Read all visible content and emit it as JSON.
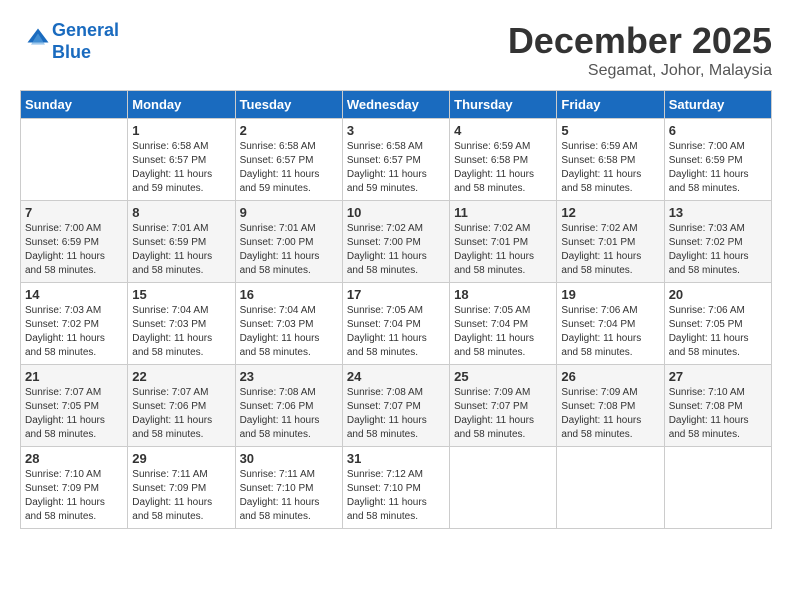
{
  "logo": {
    "line1": "General",
    "line2": "Blue"
  },
  "title": "December 2025",
  "location": "Segamat, Johor, Malaysia",
  "headers": [
    "Sunday",
    "Monday",
    "Tuesday",
    "Wednesday",
    "Thursday",
    "Friday",
    "Saturday"
  ],
  "weeks": [
    [
      {
        "day": "",
        "sunrise": "",
        "sunset": "",
        "daylight": ""
      },
      {
        "day": "1",
        "sunrise": "Sunrise: 6:58 AM",
        "sunset": "Sunset: 6:57 PM",
        "daylight": "Daylight: 11 hours and 59 minutes."
      },
      {
        "day": "2",
        "sunrise": "Sunrise: 6:58 AM",
        "sunset": "Sunset: 6:57 PM",
        "daylight": "Daylight: 11 hours and 59 minutes."
      },
      {
        "day": "3",
        "sunrise": "Sunrise: 6:58 AM",
        "sunset": "Sunset: 6:57 PM",
        "daylight": "Daylight: 11 hours and 59 minutes."
      },
      {
        "day": "4",
        "sunrise": "Sunrise: 6:59 AM",
        "sunset": "Sunset: 6:58 PM",
        "daylight": "Daylight: 11 hours and 58 minutes."
      },
      {
        "day": "5",
        "sunrise": "Sunrise: 6:59 AM",
        "sunset": "Sunset: 6:58 PM",
        "daylight": "Daylight: 11 hours and 58 minutes."
      },
      {
        "day": "6",
        "sunrise": "Sunrise: 7:00 AM",
        "sunset": "Sunset: 6:59 PM",
        "daylight": "Daylight: 11 hours and 58 minutes."
      }
    ],
    [
      {
        "day": "7",
        "sunrise": "Sunrise: 7:00 AM",
        "sunset": "Sunset: 6:59 PM",
        "daylight": "Daylight: 11 hours and 58 minutes."
      },
      {
        "day": "8",
        "sunrise": "Sunrise: 7:01 AM",
        "sunset": "Sunset: 6:59 PM",
        "daylight": "Daylight: 11 hours and 58 minutes."
      },
      {
        "day": "9",
        "sunrise": "Sunrise: 7:01 AM",
        "sunset": "Sunset: 7:00 PM",
        "daylight": "Daylight: 11 hours and 58 minutes."
      },
      {
        "day": "10",
        "sunrise": "Sunrise: 7:02 AM",
        "sunset": "Sunset: 7:00 PM",
        "daylight": "Daylight: 11 hours and 58 minutes."
      },
      {
        "day": "11",
        "sunrise": "Sunrise: 7:02 AM",
        "sunset": "Sunset: 7:01 PM",
        "daylight": "Daylight: 11 hours and 58 minutes."
      },
      {
        "day": "12",
        "sunrise": "Sunrise: 7:02 AM",
        "sunset": "Sunset: 7:01 PM",
        "daylight": "Daylight: 11 hours and 58 minutes."
      },
      {
        "day": "13",
        "sunrise": "Sunrise: 7:03 AM",
        "sunset": "Sunset: 7:02 PM",
        "daylight": "Daylight: 11 hours and 58 minutes."
      }
    ],
    [
      {
        "day": "14",
        "sunrise": "Sunrise: 7:03 AM",
        "sunset": "Sunset: 7:02 PM",
        "daylight": "Daylight: 11 hours and 58 minutes."
      },
      {
        "day": "15",
        "sunrise": "Sunrise: 7:04 AM",
        "sunset": "Sunset: 7:03 PM",
        "daylight": "Daylight: 11 hours and 58 minutes."
      },
      {
        "day": "16",
        "sunrise": "Sunrise: 7:04 AM",
        "sunset": "Sunset: 7:03 PM",
        "daylight": "Daylight: 11 hours and 58 minutes."
      },
      {
        "day": "17",
        "sunrise": "Sunrise: 7:05 AM",
        "sunset": "Sunset: 7:04 PM",
        "daylight": "Daylight: 11 hours and 58 minutes."
      },
      {
        "day": "18",
        "sunrise": "Sunrise: 7:05 AM",
        "sunset": "Sunset: 7:04 PM",
        "daylight": "Daylight: 11 hours and 58 minutes."
      },
      {
        "day": "19",
        "sunrise": "Sunrise: 7:06 AM",
        "sunset": "Sunset: 7:04 PM",
        "daylight": "Daylight: 11 hours and 58 minutes."
      },
      {
        "day": "20",
        "sunrise": "Sunrise: 7:06 AM",
        "sunset": "Sunset: 7:05 PM",
        "daylight": "Daylight: 11 hours and 58 minutes."
      }
    ],
    [
      {
        "day": "21",
        "sunrise": "Sunrise: 7:07 AM",
        "sunset": "Sunset: 7:05 PM",
        "daylight": "Daylight: 11 hours and 58 minutes."
      },
      {
        "day": "22",
        "sunrise": "Sunrise: 7:07 AM",
        "sunset": "Sunset: 7:06 PM",
        "daylight": "Daylight: 11 hours and 58 minutes."
      },
      {
        "day": "23",
        "sunrise": "Sunrise: 7:08 AM",
        "sunset": "Sunset: 7:06 PM",
        "daylight": "Daylight: 11 hours and 58 minutes."
      },
      {
        "day": "24",
        "sunrise": "Sunrise: 7:08 AM",
        "sunset": "Sunset: 7:07 PM",
        "daylight": "Daylight: 11 hours and 58 minutes."
      },
      {
        "day": "25",
        "sunrise": "Sunrise: 7:09 AM",
        "sunset": "Sunset: 7:07 PM",
        "daylight": "Daylight: 11 hours and 58 minutes."
      },
      {
        "day": "26",
        "sunrise": "Sunrise: 7:09 AM",
        "sunset": "Sunset: 7:08 PM",
        "daylight": "Daylight: 11 hours and 58 minutes."
      },
      {
        "day": "27",
        "sunrise": "Sunrise: 7:10 AM",
        "sunset": "Sunset: 7:08 PM",
        "daylight": "Daylight: 11 hours and 58 minutes."
      }
    ],
    [
      {
        "day": "28",
        "sunrise": "Sunrise: 7:10 AM",
        "sunset": "Sunset: 7:09 PM",
        "daylight": "Daylight: 11 hours and 58 minutes."
      },
      {
        "day": "29",
        "sunrise": "Sunrise: 7:11 AM",
        "sunset": "Sunset: 7:09 PM",
        "daylight": "Daylight: 11 hours and 58 minutes."
      },
      {
        "day": "30",
        "sunrise": "Sunrise: 7:11 AM",
        "sunset": "Sunset: 7:10 PM",
        "daylight": "Daylight: 11 hours and 58 minutes."
      },
      {
        "day": "31",
        "sunrise": "Sunrise: 7:12 AM",
        "sunset": "Sunset: 7:10 PM",
        "daylight": "Daylight: 11 hours and 58 minutes."
      },
      {
        "day": "",
        "sunrise": "",
        "sunset": "",
        "daylight": ""
      },
      {
        "day": "",
        "sunrise": "",
        "sunset": "",
        "daylight": ""
      },
      {
        "day": "",
        "sunrise": "",
        "sunset": "",
        "daylight": ""
      }
    ]
  ]
}
